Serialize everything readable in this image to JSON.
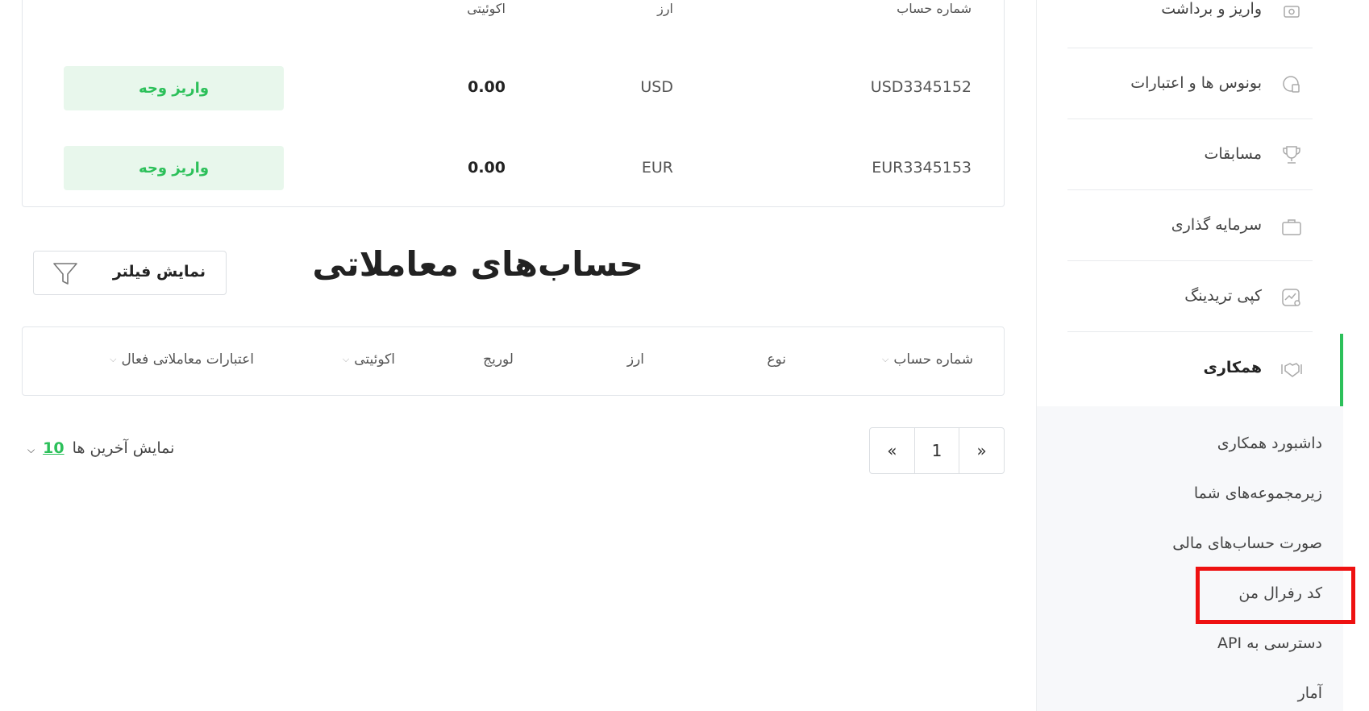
{
  "wallets": {
    "headers": {
      "account_number": "شماره حساب",
      "currency": "ارز",
      "equity": "اکوئیتی"
    },
    "rows": [
      {
        "account": "USD3345152",
        "currency": "USD",
        "equity": "0.00",
        "action": "واریز وجه"
      },
      {
        "account": "EUR3345153",
        "currency": "EUR",
        "equity": "0.00",
        "action": "واریز وجه"
      }
    ]
  },
  "trading": {
    "title": "حساب‌های معاملاتی",
    "filter_label": "نمایش فیلتر",
    "columns": [
      "شماره حساب",
      "نوع",
      "ارز",
      "لوریج",
      "اکوئیتی",
      "اعتبارات معاملاتی فعال"
    ]
  },
  "pagination": {
    "first": "«",
    "page": "1",
    "last": "»"
  },
  "show_last": {
    "label": "نمایش آخرین ها",
    "count": "10"
  },
  "sidebar": {
    "items": [
      {
        "label": "واریز و برداشت",
        "icon": "money-hand-icon"
      },
      {
        "label": "بونوس ها و اعتبارات",
        "icon": "bonus-icon"
      },
      {
        "label": "مسابقات",
        "icon": "trophy-icon"
      },
      {
        "label": "سرمایه گذاری",
        "icon": "briefcase-icon"
      },
      {
        "label": "کپی تریدینگ",
        "icon": "copy-trading-icon"
      },
      {
        "label": "همکاری",
        "icon": "handshake-icon",
        "active": true
      }
    ],
    "submenu": [
      "داشبورد همکاری",
      "زیرمجموعه‌های شما",
      "صورت حساب‌های مالی",
      "کد رفرال من",
      "دسترسی به API",
      "آمار"
    ]
  },
  "colors": {
    "accent": "#2cc05a",
    "highlight": "#ee1111"
  }
}
